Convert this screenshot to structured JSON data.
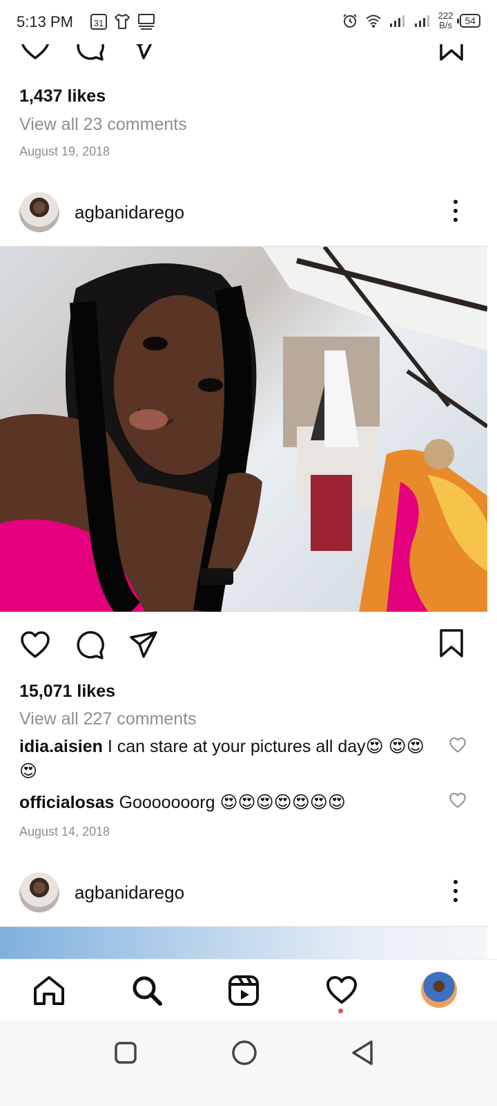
{
  "status_bar": {
    "time": "5:13 PM",
    "calendar_day": "31",
    "net_speed_value": "222",
    "net_speed_unit": "B/s",
    "battery": "54"
  },
  "post_1": {
    "likes": "1,437 likes",
    "view_comments": "View all 23 comments",
    "date": "August 19, 2018"
  },
  "post_2": {
    "username": "agbanidarego",
    "likes": "15,071 likes",
    "view_comments": "View all 227 comments",
    "comments": [
      {
        "user": "idia.aisien",
        "text": "I can stare at your pictures all day😍 😍😍😍"
      },
      {
        "user": "officialosas",
        "text": "Gooooooorg 😍😍😍😍😍😍😍"
      }
    ],
    "date": "August 14, 2018"
  },
  "post_3": {
    "username": "agbanidarego"
  },
  "colors": {
    "accent_pink": "#e4007c",
    "notification_dot": "#ed4956",
    "secondary_text": "#8e8e8e"
  },
  "icons": {
    "post_actions": [
      "heart-icon",
      "comment-icon",
      "share-icon",
      "bookmark-icon"
    ],
    "bottom_nav": [
      "home-icon",
      "search-icon",
      "reels-icon",
      "activity-heart-icon",
      "profile-avatar"
    ],
    "system_nav": [
      "recents-square-icon",
      "home-circle-icon",
      "back-triangle-icon"
    ]
  }
}
